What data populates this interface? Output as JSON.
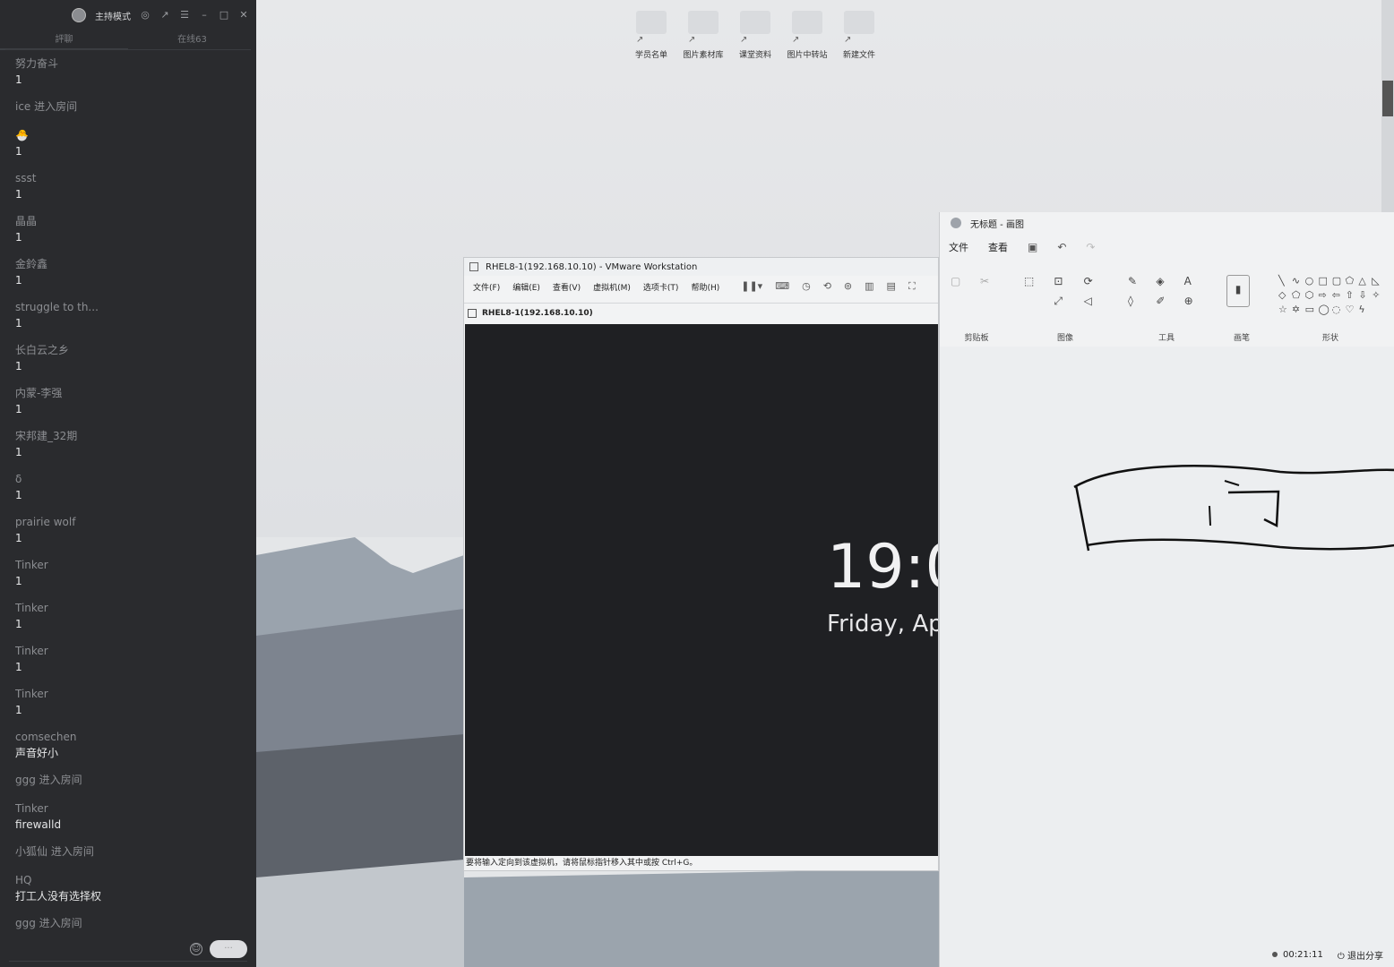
{
  "chat": {
    "mode_label": "主持模式",
    "tabs": [
      "評聊",
      "在线63"
    ],
    "messages": [
      {
        "name": "努力奋斗",
        "text": "1"
      },
      {
        "name": "ice 进入房间",
        "text": ""
      },
      {
        "name": "🐣",
        "text": "1"
      },
      {
        "name": "ssst",
        "text": "1"
      },
      {
        "name": "晶晶",
        "text": "1"
      },
      {
        "name": "金鈴鑫",
        "text": "1"
      },
      {
        "name": "struggle to th...",
        "text": "1"
      },
      {
        "name": "长白云之乡",
        "text": "1"
      },
      {
        "name": "内蒙-李强",
        "text": "1"
      },
      {
        "name": "宋邦建_32期",
        "text": "1"
      },
      {
        "name": "δ",
        "text": "1"
      },
      {
        "name": "prairie wolf",
        "text": "1"
      },
      {
        "name": "Tinker",
        "text": "1"
      },
      {
        "name": "Tinker",
        "text": "1"
      },
      {
        "name": "Tinker",
        "text": "1"
      },
      {
        "name": "Tinker",
        "text": "1"
      },
      {
        "name": "comsechen",
        "text": "声音好小"
      },
      {
        "name": "ggg 进入房间",
        "text": ""
      },
      {
        "name": "Tinker",
        "text": "firewalld"
      },
      {
        "name": "小狐仙 进入房间",
        "text": ""
      },
      {
        "name": "HQ",
        "text": "打工人没有选择权"
      },
      {
        "name": "ggg 进入房间",
        "text": ""
      }
    ]
  },
  "desktop": {
    "shortcuts": [
      "学员名单",
      "图片素材库",
      "课堂资料",
      "图片中转站",
      "新建文件"
    ]
  },
  "vmware": {
    "title": "RHEL8-1(192.168.10.10) - VMware Workstation",
    "menu": [
      "文件(F)",
      "编辑(E)",
      "查看(V)",
      "虚拟机(M)",
      "选项卡(T)",
      "帮助(H)"
    ],
    "tab_label": "RHEL8-1(192.168.10.10)",
    "clock": "19:0",
    "date": "Friday, Ap",
    "status": "要将输入定向到该虚拟机，请将鼠标指针移入其中或按 Ctrl+G。"
  },
  "paint": {
    "title": "无标题 - 画图",
    "menu": [
      "文件",
      "查看"
    ],
    "groups": [
      "剪贴板",
      "图像",
      "工具",
      "画笔",
      "形状"
    ],
    "timer": "00:21:11",
    "exit_share": "退出分享"
  },
  "colors": {
    "chat_bg": "#2a2b2e",
    "vm_screen": "#1f2023",
    "paint_bg": "#eceef0"
  }
}
